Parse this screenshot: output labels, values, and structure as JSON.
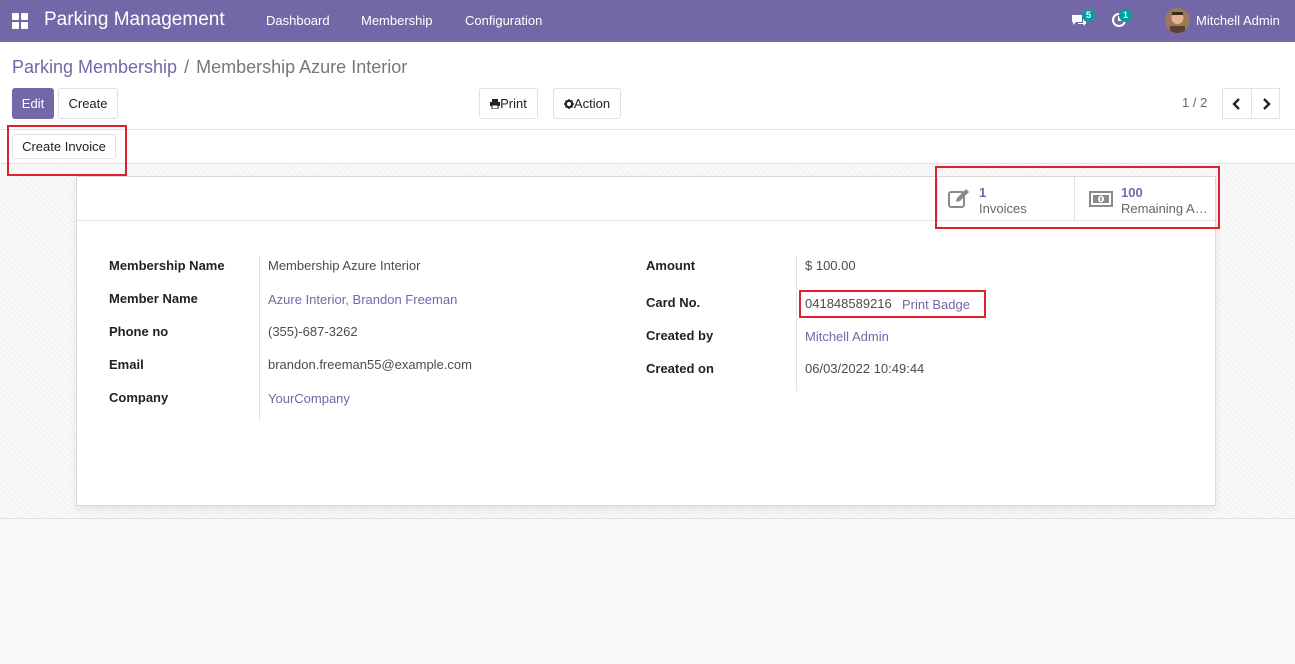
{
  "navbar": {
    "brand": "Parking Management",
    "menu": [
      "Dashboard",
      "Membership",
      "Configuration"
    ],
    "chat_count": "5",
    "activity_count": "1",
    "user": "Mitchell Admin"
  },
  "breadcrumb": {
    "parent": "Parking Membership",
    "separator": "/",
    "current": "Membership Azure Interior"
  },
  "buttons": {
    "edit": "Edit",
    "create": "Create",
    "print": "Print",
    "action": "Action",
    "create_invoice": "Create Invoice"
  },
  "pager": {
    "value": "1 / 2"
  },
  "smart_buttons": [
    {
      "value": "1",
      "label": "Invoices",
      "icon": "edit-icon"
    },
    {
      "value": "100",
      "label": "Remaining A…",
      "icon": "money-icon"
    }
  ],
  "fields_left": [
    {
      "label": "Membership Name",
      "value": "Membership Azure Interior",
      "link": false
    },
    {
      "label": "Member Name",
      "value": "Azure Interior, Brandon Freeman",
      "link": true
    },
    {
      "label": "Phone no",
      "value": "(355)-687-3262",
      "link": false
    },
    {
      "label": "Email",
      "value": "brandon.freeman55@example.com",
      "link": false
    },
    {
      "label": "Company",
      "value": "YourCompany",
      "link": true
    }
  ],
  "fields_right": [
    {
      "label": "Amount",
      "value": "$ 100.00",
      "link": false
    },
    {
      "label": "Card No.",
      "value": "041848589216",
      "link": false,
      "extra": "Print Badge"
    },
    {
      "label": "Created by",
      "value": "Mitchell Admin",
      "link": true
    },
    {
      "label": "Created on",
      "value": "06/03/2022 10:49:44",
      "link": false
    }
  ],
  "colors": {
    "primary": "#7467a7",
    "highlight": "#e0202a",
    "badge": "#00a09d"
  }
}
